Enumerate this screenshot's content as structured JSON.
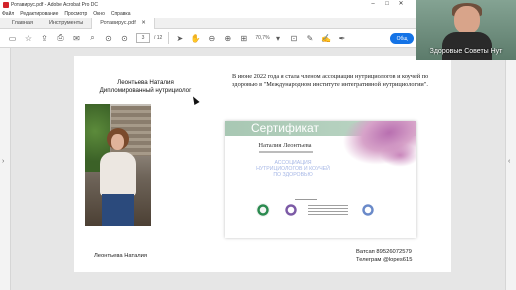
{
  "window": {
    "title": "Ротавирус.pdf - Adobe Acrobat Pro DC",
    "minimize_icon": "minimize-icon",
    "maximize_icon": "maximize-icon",
    "close_icon": "close-icon"
  },
  "menu": {
    "items": [
      "Файл",
      "Редактирование",
      "Просмотр",
      "Окно",
      "Справка"
    ]
  },
  "tabs": {
    "home": "Главная",
    "tools": "Инструменты",
    "document": "Ротавирус.pdf"
  },
  "toolbar": {
    "current_page": "3",
    "total_pages": "/ 12",
    "zoom": "70,7%",
    "share_label": "Общ"
  },
  "page": {
    "name_line1": "Леонтьева Наталия",
    "name_line2": "Дипломированный нутрициолог",
    "paragraph": "В июне 2022 года я стала членом ассоциации нутрициологов и коучей по здоровью в \"Международном институте интегративной нутрициологии\".",
    "certificate": {
      "heading": "Сертификат",
      "holder": "Наталия Леонтьева",
      "org_line1": "АССОЦИАЦИЯ",
      "org_line2": "НУТРИЦИОЛОГОВ И КОУЧЕЙ",
      "org_line3": "ПО ЗДОРОВЬЮ"
    },
    "footer_name": "Леонтьева Наталия",
    "contact_whatsapp": "Ватсап 89526072579",
    "contact_telegram": "Телеграм @lopes615"
  },
  "webcam": {
    "caption": "Здоровые Советы Нут"
  },
  "colors": {
    "share_button": "#1473e6",
    "cert_band": "#a8c7b3",
    "cert_org_text": "#a6b7e6"
  }
}
